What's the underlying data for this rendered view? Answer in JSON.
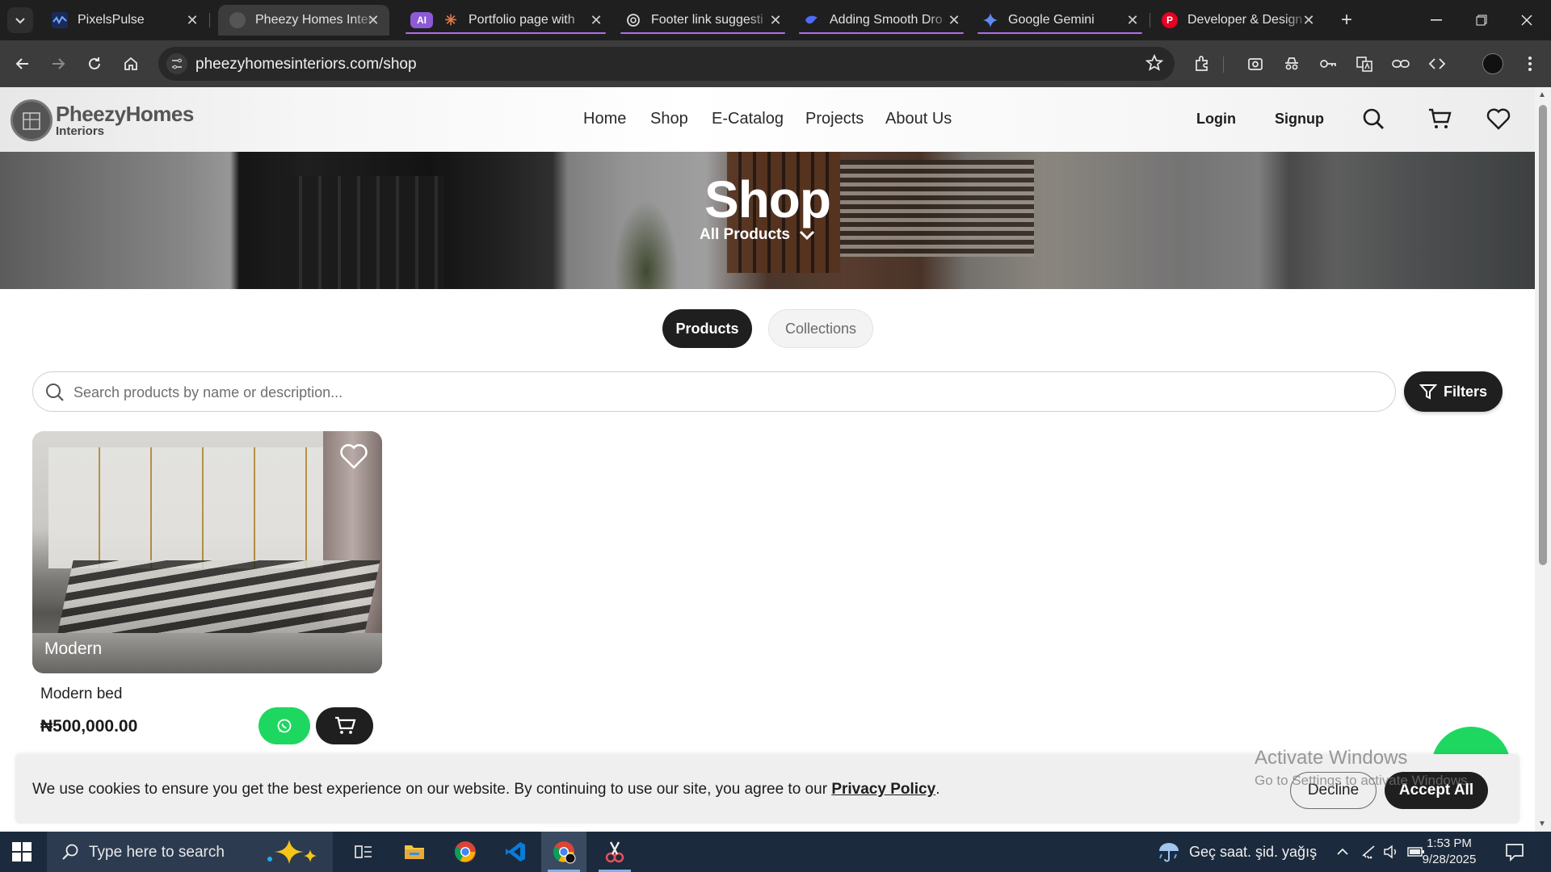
{
  "browser": {
    "tabs": [
      {
        "title": "PixelsPulse",
        "active": false
      },
      {
        "title": "Pheezy Homes Interiors",
        "active": true
      },
      {
        "title": "Portfolio page with",
        "active": false,
        "group_badge": "AI"
      },
      {
        "title": "Footer link suggesti",
        "active": false
      },
      {
        "title": "Adding Smooth Dro",
        "active": false
      },
      {
        "title": "Google Gemini",
        "active": false
      },
      {
        "title": "Developer & Design",
        "active": false
      }
    ],
    "url": "pheezyhomesinteriors.com/shop",
    "accent_color": "#b06ee8"
  },
  "site": {
    "logo": {
      "line1": "PheezyHomes",
      "line2": "Interiors"
    },
    "nav": [
      "Home",
      "Shop",
      "E-Catalog",
      "Projects",
      "About Us"
    ],
    "login": "Login",
    "signup": "Signup",
    "header_icons": [
      "search-icon",
      "cart-icon",
      "heart-icon"
    ]
  },
  "hero": {
    "title": "Shop",
    "dropdown": "All Products"
  },
  "segments": {
    "products": "Products",
    "collections": "Collections",
    "selected": "Products"
  },
  "search": {
    "placeholder": "Search products by name or description...",
    "value": ""
  },
  "filters_label": "Filters",
  "products": [
    {
      "badge": "Modern",
      "name": "Modern bed",
      "price": "₦500,000.00"
    }
  ],
  "cookie": {
    "message": "We use cookies to ensure you get the best experience on our website. By continuing to use our site, you agree to our",
    "link": "Privacy Policy",
    "suffix": ".",
    "decline": "Decline",
    "accept": "Accept All"
  },
  "watermark": {
    "line1": "Activate Windows",
    "line2": "Go to Settings to activate Windows."
  },
  "taskbar": {
    "search_placeholder": "Type here to search",
    "weather": "Geç saat. şid. yağış",
    "time": "1:53 PM",
    "date": "9/28/2025"
  },
  "colors": {
    "whatsapp_green": "#1ed760",
    "dark": "#1f1f1f"
  }
}
